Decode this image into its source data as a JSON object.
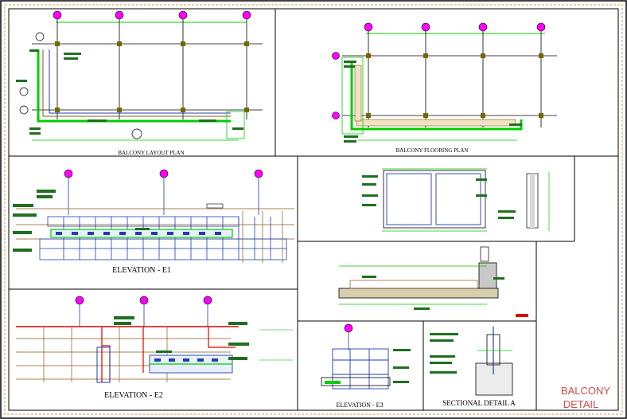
{
  "sheet": {
    "title_line1": "BALCONY",
    "title_line2": "DETAIL",
    "colors": {
      "frame": "#000000",
      "border_dash": "#c9a24b",
      "grid": "#00cc00",
      "column": "#6e6a00",
      "bubble": "#ff00ff",
      "note_block": "#1f6f1f",
      "dim": "#00aa00",
      "brick": "#8a5a1a",
      "glass": "#1e3fb0",
      "wall_red": "#e00000",
      "title_red": "#d84a4a"
    }
  },
  "views": {
    "balcony_layout_plan": "BALCONY LAYOUT PLAN",
    "balcony_flooring_plan": "BALCONY FLOORING PLAN",
    "elevation_e1": "ELEVATION - E1",
    "elevation_e2": "ELEVATION - E2",
    "elevation_e3": "ELEVATION - E3",
    "sectional_detail_a": "SECTIONAL DETAIL A"
  }
}
